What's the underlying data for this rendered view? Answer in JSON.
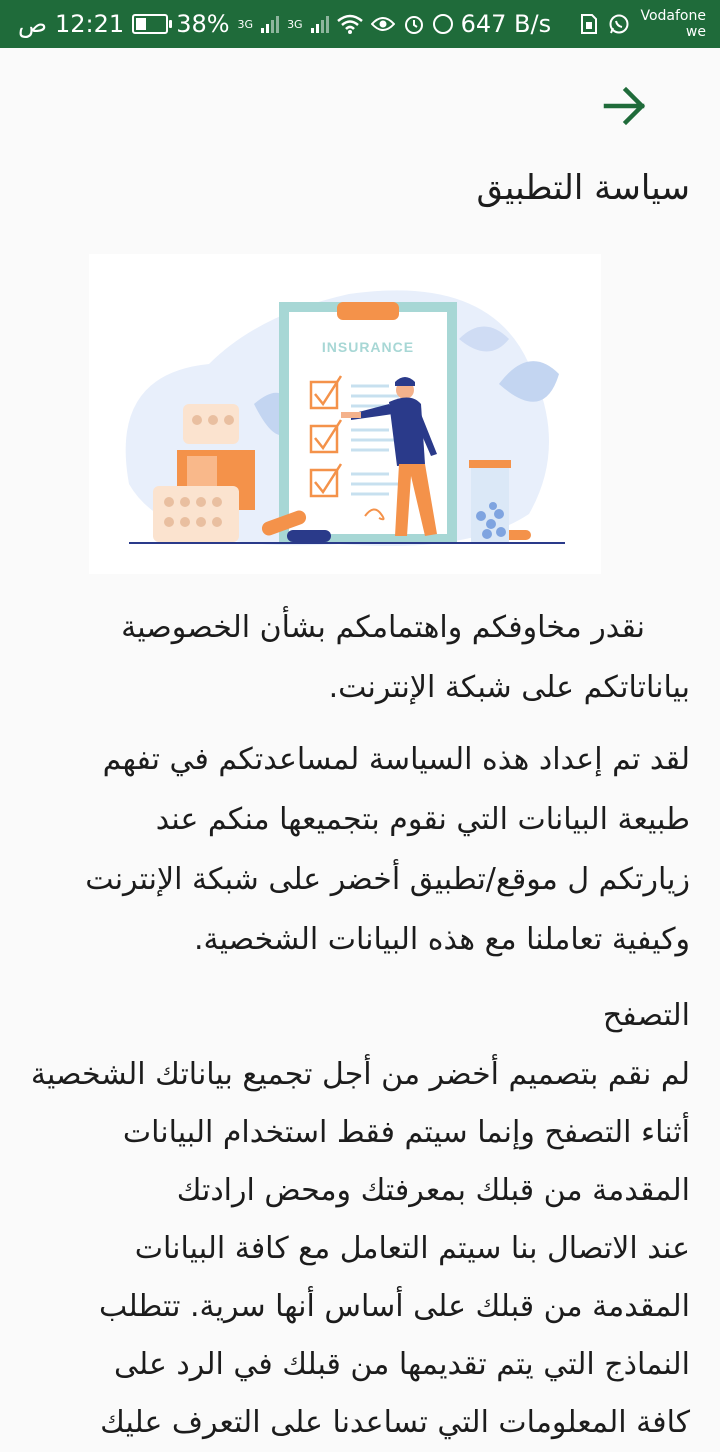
{
  "status_bar": {
    "time": "12:21",
    "am_pm": "ص",
    "battery": "38%",
    "net1": "3G",
    "net2": "3G",
    "speed": "647 B/s",
    "carrier_line1": "Vodafone",
    "carrier_line2": "we",
    "icons": [
      "battery-icon",
      "signal-icon",
      "signal-icon",
      "wifi-icon",
      "eye-icon",
      "alarm-icon",
      "data-saver-icon",
      "sim-icon",
      "whatsapp-icon"
    ],
    "bar_color": "#1f6b3a"
  },
  "header": {
    "back_icon": "arrow-right-icon",
    "accent": "#1f6b3a",
    "title": "سياسة التطبيق"
  },
  "illustration": {
    "insurance_label": "INSURANCE"
  },
  "content": {
    "p1_line1": "نقدر مخاوفكم واهتمامكم بشأن الخصوصية",
    "p1_line2": "بياناتاتكم على شبكة الإنترنت.",
    "p2_line1": "لقد تم إعداد هذه السياسة لمساعدتكم في تفهم",
    "p2_line2": "طبيعة البيانات التي نقوم بتجميعها منكم عند",
    "p2_line3": "زيارتكم ل موقع/تطبيق أخضر على شبكة الإنترنت",
    "p2_line4": "وكيفية تعاملنا مع هذه البيانات الشخصية.",
    "section_heading": "التصفح",
    "p3_lines": [
      "لم نقم بتصميم أخضر من أجل تجميع بياناتك الشخصية",
      "أثناء التصفح وإنما سيتم فقط استخدام البيانات",
      "المقدمة من قبلك بمعرفتك ومحض ارادتك",
      "عند الاتصال بنا سيتم التعامل مع كافة البيانات",
      "المقدمة من قبلك على أساس أنها سرية. تتطلب",
      "النماذج التي يتم تقديمها من قبلك في الرد على",
      "كافة المعلومات التي تساعدنا على التعرف عليك"
    ]
  }
}
